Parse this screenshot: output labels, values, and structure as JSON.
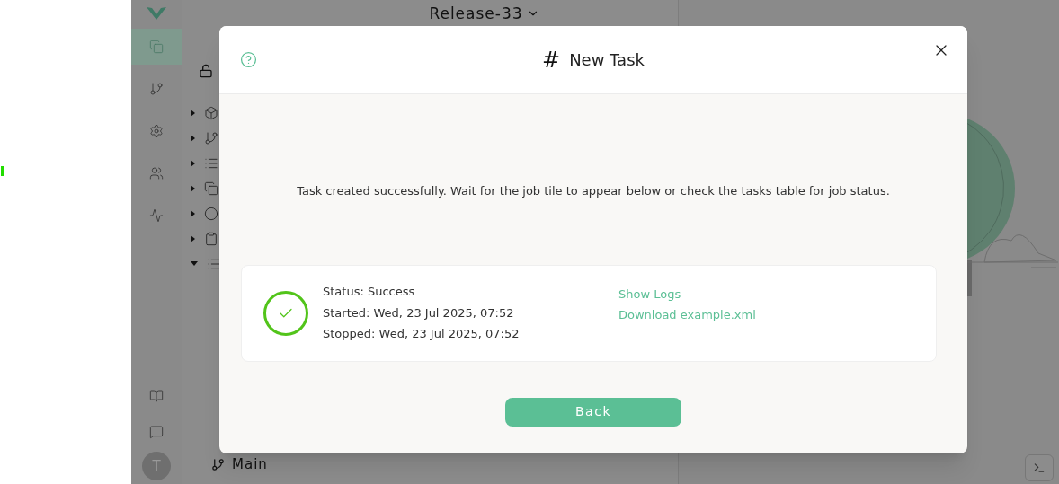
{
  "sidebar": {
    "items": [
      {
        "kind": "copy",
        "selected": true
      },
      {
        "kind": "branch",
        "selected": false
      },
      {
        "kind": "settings",
        "selected": false
      },
      {
        "kind": "users",
        "selected": false
      },
      {
        "kind": "activity",
        "selected": false
      }
    ],
    "bottom_items": [
      {
        "kind": "book"
      },
      {
        "kind": "chat"
      }
    ],
    "avatar": "T"
  },
  "project": {
    "release": "Release-33",
    "tree": [
      {
        "kind": "box",
        "expanded": false
      },
      {
        "kind": "branch",
        "expanded": false
      },
      {
        "kind": "list",
        "expanded": false
      },
      {
        "kind": "copy",
        "expanded": false
      },
      {
        "kind": "circle",
        "expanded": false
      },
      {
        "kind": "clipboard",
        "expanded": false
      },
      {
        "kind": "list",
        "expanded": true
      }
    ],
    "branch": "Main"
  },
  "modal": {
    "title": "New Task",
    "title_icon": "#",
    "message": "Task created successfully. Wait for the job tile to appear below or check the tasks table for job status.",
    "job": {
      "succeeded": true,
      "lines": [
        "Status: Success",
        "Started: Wed, 23 Jul 2025, 07:52",
        "Stopped: Wed, 23 Jul 2025, 07:52"
      ],
      "links": [
        "Show Logs",
        "Download example.xml"
      ]
    },
    "button": "Back"
  }
}
